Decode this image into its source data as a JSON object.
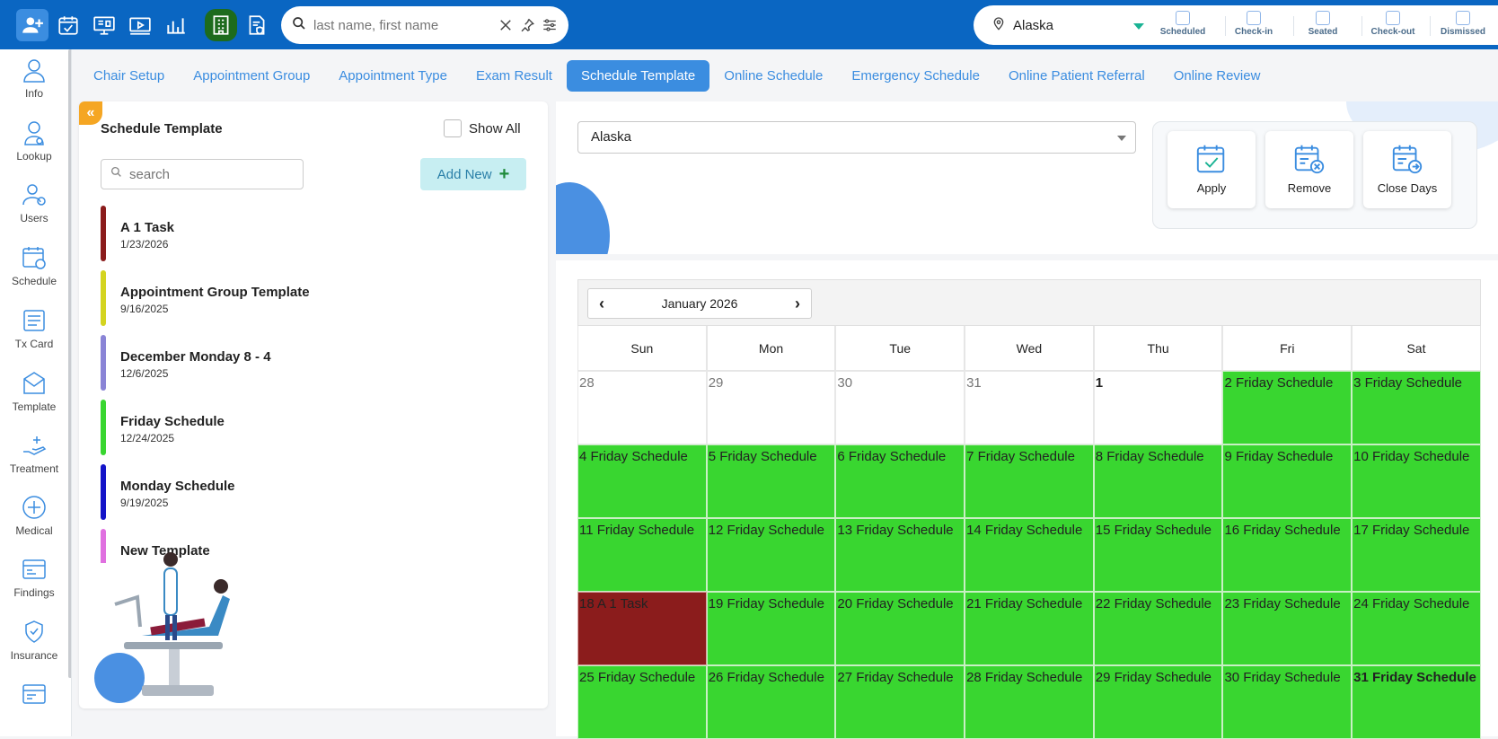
{
  "topbar": {
    "icons": [
      "add-patient-icon",
      "calendar-check-icon",
      "monitor-icon",
      "video-icon",
      "analytics-icon",
      "building-icon",
      "document-shield-icon"
    ],
    "search": {
      "placeholder": "last name, first name"
    },
    "location": "Alaska",
    "statuses": [
      "Scheduled",
      "Check-in",
      "Seated",
      "Check-out",
      "Dismissed"
    ]
  },
  "leftnav": [
    {
      "label": "Info",
      "icon": "person-icon"
    },
    {
      "label": "Lookup",
      "icon": "doctor-icon"
    },
    {
      "label": "Users",
      "icon": "users-icon"
    },
    {
      "label": "Schedule",
      "icon": "schedule-icon"
    },
    {
      "label": "Tx Card",
      "icon": "tx-card-icon"
    },
    {
      "label": "Template",
      "icon": "template-icon"
    },
    {
      "label": "Treatment",
      "icon": "treatment-icon"
    },
    {
      "label": "Medical",
      "icon": "medical-icon"
    },
    {
      "label": "Findings",
      "icon": "findings-icon"
    },
    {
      "label": "Insurance",
      "icon": "insurance-icon"
    },
    {
      "label": "",
      "icon": "card-icon"
    }
  ],
  "tabs": [
    {
      "label": "Chair Setup",
      "active": false
    },
    {
      "label": "Appointment Group",
      "active": false
    },
    {
      "label": "Appointment Type",
      "active": false
    },
    {
      "label": "Exam Result",
      "active": false
    },
    {
      "label": "Schedule Template",
      "active": true
    },
    {
      "label": "Online Schedule",
      "active": false
    },
    {
      "label": "Emergency Schedule",
      "active": false
    },
    {
      "label": "Online Patient Referral",
      "active": false
    },
    {
      "label": "Online Review",
      "active": false
    }
  ],
  "panel": {
    "collapse_glyph": "«",
    "title": "Schedule Template",
    "show_all": "Show All",
    "search_placeholder": "search",
    "add_new": "Add New",
    "add_plus": "+",
    "templates": [
      {
        "name": "A 1 Task",
        "date": "1/23/2026",
        "color": "#8b1c1c"
      },
      {
        "name": "Appointment Group Template",
        "date": "9/16/2025",
        "color": "#d4d420"
      },
      {
        "name": "December Monday 8 - 4",
        "date": "12/6/2025",
        "color": "#8a84d6"
      },
      {
        "name": "Friday Schedule",
        "date": "12/24/2025",
        "color": "#39d630"
      },
      {
        "name": "Monday Schedule",
        "date": "9/19/2025",
        "color": "#1414c8"
      },
      {
        "name": "New Template",
        "date": "",
        "color": "#e070e0"
      }
    ]
  },
  "location_select": "Alaska",
  "actions": [
    {
      "label": "Apply",
      "icon": "calendar-apply-icon"
    },
    {
      "label": "Remove",
      "icon": "calendar-remove-icon"
    },
    {
      "label": "Close Days",
      "icon": "calendar-close-icon"
    }
  ],
  "calendar": {
    "month": "January 2026",
    "prev": "‹",
    "next": "›",
    "days_of_week": [
      "Sun",
      "Mon",
      "Tue",
      "Wed",
      "Thu",
      "Fri",
      "Sat"
    ],
    "weeks": [
      [
        {
          "text": "28",
          "style": "muted"
        },
        {
          "text": "29",
          "style": "muted"
        },
        {
          "text": "30",
          "style": "muted"
        },
        {
          "text": "31",
          "style": "muted"
        },
        {
          "text": "1",
          "style": "bold"
        },
        {
          "text": "2 Friday Schedule",
          "style": "green"
        },
        {
          "text": "3 Friday Schedule",
          "style": "green"
        }
      ],
      [
        {
          "text": "4 Friday Schedule",
          "style": "green"
        },
        {
          "text": "5 Friday Schedule",
          "style": "green"
        },
        {
          "text": "6 Friday Schedule",
          "style": "green"
        },
        {
          "text": "7 Friday Schedule",
          "style": "green"
        },
        {
          "text": "8 Friday Schedule",
          "style": "green"
        },
        {
          "text": "9 Friday Schedule",
          "style": "green"
        },
        {
          "text": "10 Friday Schedule",
          "style": "green"
        }
      ],
      [
        {
          "text": "11 Friday Schedule",
          "style": "green"
        },
        {
          "text": "12 Friday Schedule",
          "style": "green"
        },
        {
          "text": "13 Friday Schedule",
          "style": "green"
        },
        {
          "text": "14 Friday Schedule",
          "style": "green"
        },
        {
          "text": "15 Friday Schedule",
          "style": "green"
        },
        {
          "text": "16 Friday Schedule",
          "style": "green"
        },
        {
          "text": "17 Friday Schedule",
          "style": "green"
        }
      ],
      [
        {
          "text": "18 A 1 Task",
          "style": "maroon"
        },
        {
          "text": "19 Friday Schedule",
          "style": "green"
        },
        {
          "text": "20 Friday Schedule",
          "style": "green"
        },
        {
          "text": "21 Friday Schedule",
          "style": "green"
        },
        {
          "text": "22 Friday Schedule",
          "style": "green"
        },
        {
          "text": "23 Friday Schedule",
          "style": "green"
        },
        {
          "text": "24 Friday Schedule",
          "style": "green"
        }
      ],
      [
        {
          "text": "25 Friday Schedule",
          "style": "green"
        },
        {
          "text": "26 Friday Schedule",
          "style": "green"
        },
        {
          "text": "27 Friday Schedule",
          "style": "green"
        },
        {
          "text": "28 Friday Schedule",
          "style": "green"
        },
        {
          "text": "29 Friday Schedule",
          "style": "green"
        },
        {
          "text": "30 Friday Schedule",
          "style": "green"
        },
        {
          "text": "31 Friday Schedule",
          "style": "green bold"
        }
      ]
    ]
  }
}
